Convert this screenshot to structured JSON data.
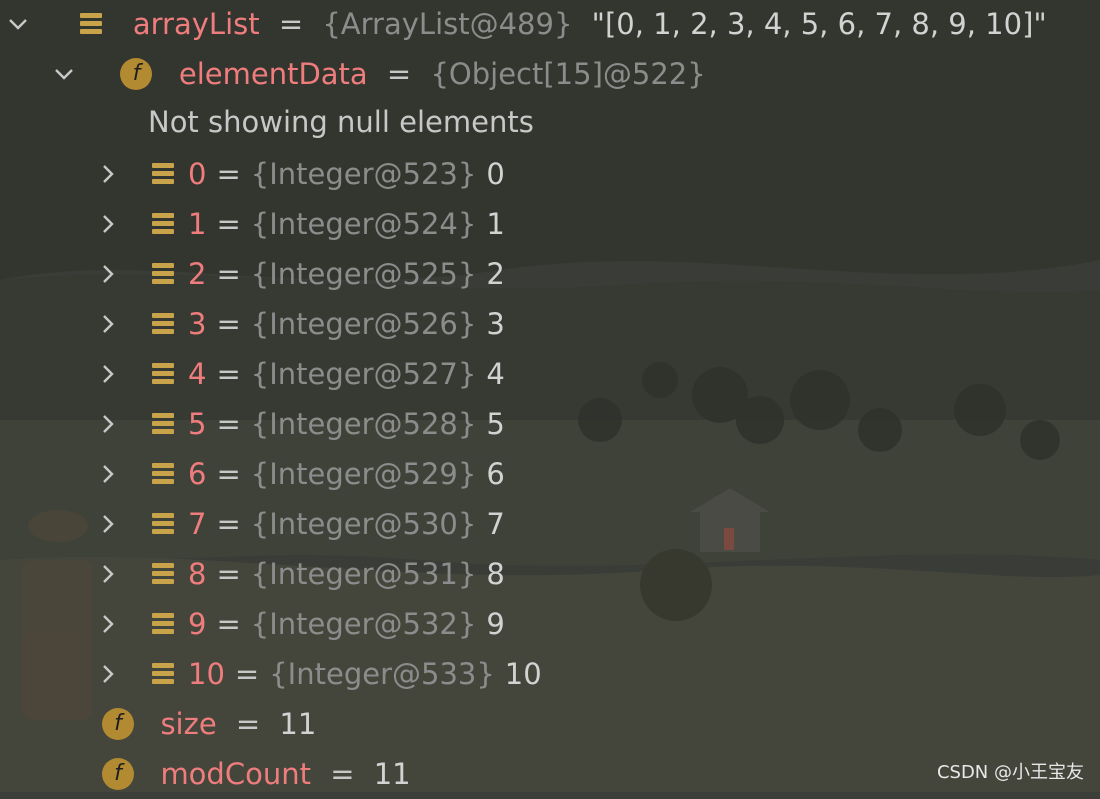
{
  "root": {
    "name": "arrayList",
    "eq": "=",
    "type": "{ArrayList@489}",
    "value": "\"[0, 1, 2, 3, 4, 5, 6, 7, 8, 9, 10]\""
  },
  "elementData": {
    "name": "elementData",
    "eq": "=",
    "type": "{Object[15]@522}",
    "note": "Not showing null elements",
    "field_icon_letter": "f"
  },
  "items": [
    {
      "index": "0",
      "eq": "=",
      "type": "{Integer@523}",
      "value": "0"
    },
    {
      "index": "1",
      "eq": "=",
      "type": "{Integer@524}",
      "value": "1"
    },
    {
      "index": "2",
      "eq": "=",
      "type": "{Integer@525}",
      "value": "2"
    },
    {
      "index": "3",
      "eq": "=",
      "type": "{Integer@526}",
      "value": "3"
    },
    {
      "index": "4",
      "eq": "=",
      "type": "{Integer@527}",
      "value": "4"
    },
    {
      "index": "5",
      "eq": "=",
      "type": "{Integer@528}",
      "value": "5"
    },
    {
      "index": "6",
      "eq": "=",
      "type": "{Integer@529}",
      "value": "6"
    },
    {
      "index": "7",
      "eq": "=",
      "type": "{Integer@530}",
      "value": "7"
    },
    {
      "index": "8",
      "eq": "=",
      "type": "{Integer@531}",
      "value": "8"
    },
    {
      "index": "9",
      "eq": "=",
      "type": "{Integer@532}",
      "value": "9"
    },
    {
      "index": "10",
      "eq": "=",
      "type": "{Integer@533}",
      "value": "10"
    }
  ],
  "size": {
    "name": "size",
    "eq": "=",
    "value": "11",
    "field_icon_letter": "f"
  },
  "modCount": {
    "name": "modCount",
    "eq": "=",
    "value": "11",
    "field_icon_letter": "f"
  },
  "watermark": "CSDN @小王宝友",
  "colors": {
    "name": "#ef7d7d",
    "type": "#8c8c8c",
    "value": "#d2d2d2",
    "icon": "#c9a34a",
    "field_icon": "#b18a32"
  }
}
